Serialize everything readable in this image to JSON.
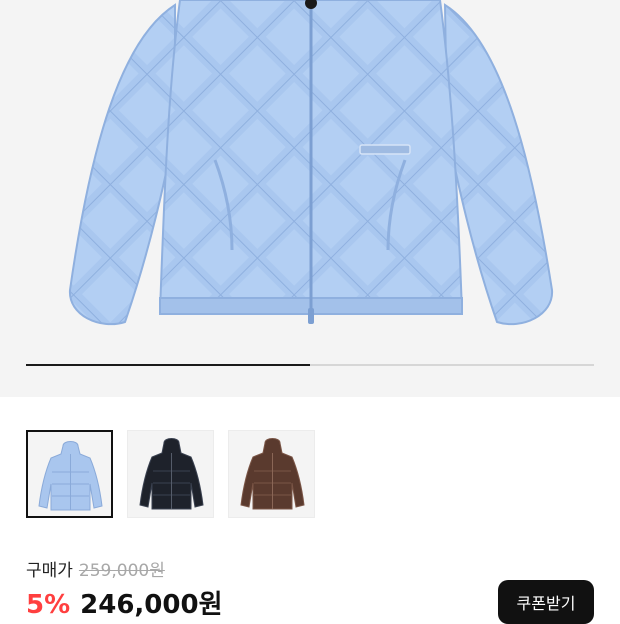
{
  "gallery": {
    "progress_fraction": 0.5,
    "main_image_icon": "light-blue-down-jacket",
    "thumbnails": [
      {
        "icon": "light-blue-jacket",
        "color": "#a9c6ee",
        "selected": true
      },
      {
        "icon": "black-jacket",
        "color": "#1e222b",
        "selected": false
      },
      {
        "icon": "brown-jacket",
        "color": "#5a3a2e",
        "selected": false
      }
    ]
  },
  "pricing": {
    "label": "구매가",
    "original_price": "259,000원",
    "discount": "5%",
    "sale_price": "246,000원",
    "discount_color": "#ff3f3f"
  },
  "coupon": {
    "label": "쿠폰받기"
  }
}
